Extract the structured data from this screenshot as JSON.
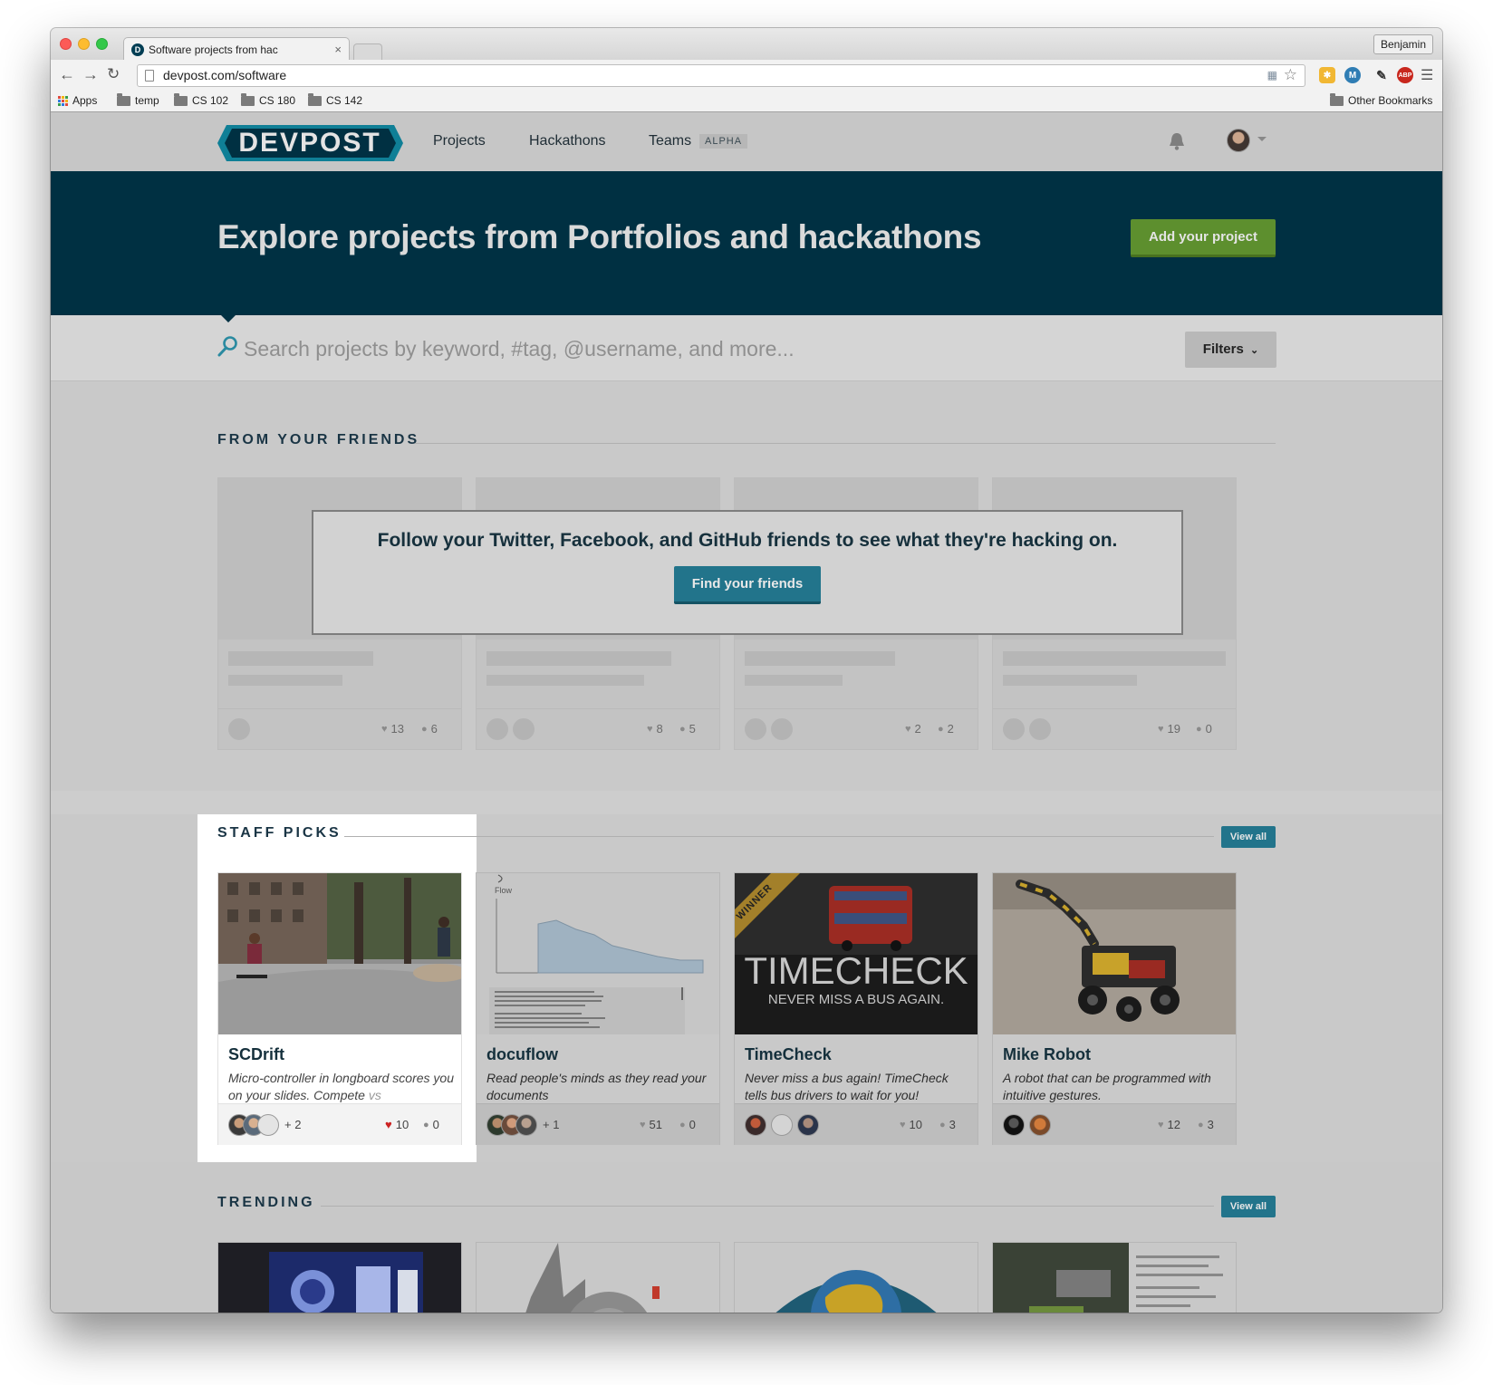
{
  "browser": {
    "tab_title": "Software projects from hac",
    "tab_close": "×",
    "profile_name": "Benjamin",
    "url": "devpost.com/software",
    "bookmarks": [
      "Apps",
      "temp",
      "CS 102",
      "CS 180",
      "CS 142"
    ],
    "other_bookmarks": "Other Bookmarks",
    "extensions": [
      "M",
      "ABP"
    ]
  },
  "nav": {
    "logo": "DEVPOST",
    "links": [
      "Projects",
      "Hackathons",
      "Teams"
    ],
    "teams_badge": "ALPHA"
  },
  "hero": {
    "title": "Explore projects from Portfolios and hackathons",
    "button": "Add your project"
  },
  "search": {
    "placeholder": "Search projects by keyword, #tag, @username, and more...",
    "filters": "Filters"
  },
  "friends": {
    "heading": "FROM YOUR FRIENDS",
    "prompt": "Follow your Twitter, Facebook, and GitHub friends to see what they're hacking on.",
    "button": "Find your friends",
    "placeholder_stats": [
      {
        "likes": "13",
        "comments": "6"
      },
      {
        "likes": "8",
        "comments": "5"
      },
      {
        "likes": "2",
        "comments": "2"
      },
      {
        "likes": "19",
        "comments": "0"
      }
    ]
  },
  "staff_picks": {
    "heading": "STAFF PICKS",
    "view_all": "View all",
    "cards": [
      {
        "title": "SCDrift",
        "desc": "Micro-controller in longboard scores you on your slides. Compete",
        "desc_faded": "vs",
        "more": "+ 2",
        "likes": "10",
        "comments": "0"
      },
      {
        "title": "docuflow",
        "desc": "Read people's minds as they read your documents",
        "more": "+ 1",
        "likes": "51",
        "comments": "0",
        "thumb_label": "Flow"
      },
      {
        "title": "TimeCheck",
        "desc": "Never miss a bus again! TimeCheck tells bus drivers to wait for you!",
        "likes": "10",
        "comments": "3",
        "ribbon": "WINNER",
        "thumb_title": "TIMECHECK",
        "thumb_sub": "NEVER MISS A BUS AGAIN."
      },
      {
        "title": "Mike Robot",
        "desc": "A robot that can be programmed with intuitive gestures.",
        "likes": "12",
        "comments": "3"
      }
    ]
  },
  "trending": {
    "heading": "TRENDING",
    "view_all": "View all"
  },
  "colors": {
    "hero_bg": "#003042",
    "accent_teal": "#22748b",
    "accent_green": "#5d8f2e",
    "like_red": "#cc2222"
  },
  "icons": [
    "back-icon",
    "forward-icon",
    "reload-icon",
    "star-icon",
    "menu-icon",
    "bell-icon",
    "search-icon",
    "heart-icon",
    "comment-icon",
    "chevron-down-icon"
  ]
}
